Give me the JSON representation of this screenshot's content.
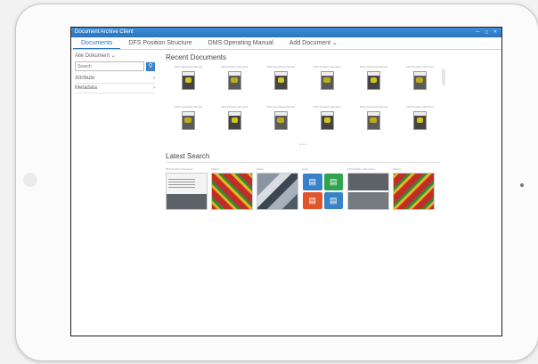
{
  "app": {
    "title": "Document Archive Client",
    "window_controls": "— ◻ ✕"
  },
  "tabs": [
    {
      "label": "Documents",
      "active": true
    },
    {
      "label": "DFS Position Structure"
    },
    {
      "label": "DMS Operating Manual"
    },
    {
      "label": "Add Document ⌄"
    }
  ],
  "sidebar": {
    "doc_select": "Alle Dokument ⌄",
    "search_placeholder": "Search",
    "search_icon": "search-icon",
    "facets": [
      {
        "label": "Attribute",
        "arrow": "›"
      },
      {
        "label": "Metadata",
        "arrow": "›"
      }
    ]
  },
  "recent": {
    "title": "Recent Documents",
    "pager": "• • •",
    "docs": [
      {
        "label": "DFS Operating Manual"
      },
      {
        "label": "DFS Position Structure"
      },
      {
        "label": "DFS Operating Manual"
      },
      {
        "label": "DFS Position Structure"
      },
      {
        "label": "DFS Operating Manual"
      },
      {
        "label": "DFS Position Structure"
      },
      {
        "label": "DFS Operating Manual"
      },
      {
        "label": "DFS Position Structure"
      },
      {
        "label": "DFS Operating Manual"
      },
      {
        "label": "DFS Position Structure"
      },
      {
        "label": "DFS Operating Manual"
      },
      {
        "label": "DFS Position Structure"
      }
    ]
  },
  "latest": {
    "title": "Latest Search",
    "items": [
      {
        "label": "DFS Position Structure",
        "kind": "doc"
      },
      {
        "label": "Pattern",
        "kind": "pattern"
      },
      {
        "label": "Photo",
        "kind": "photo"
      },
      {
        "label": "Icons",
        "kind": "icons",
        "icons": [
          "doc-blue-icon",
          "doc-green-icon",
          "doc-red-icon",
          "doc-blue-icon"
        ]
      },
      {
        "label": "DFS Position Structure",
        "kind": "collage"
      },
      {
        "label": "Pattern",
        "kind": "pattern2"
      }
    ]
  },
  "colors": {
    "accent": "#2a73be",
    "titlebar": "#3f8fd8",
    "red": "#c32d27",
    "yellow": "#e6b321",
    "green": "#2f8a3c"
  }
}
